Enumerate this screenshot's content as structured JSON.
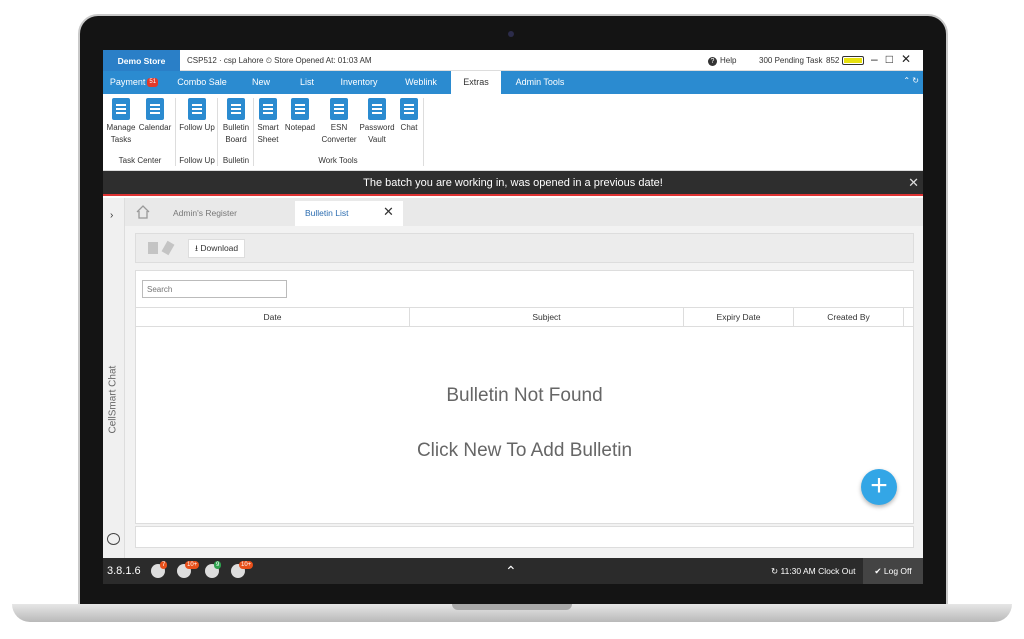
{
  "titlebar": {
    "store": "Demo Store",
    "info": "CSP512  ·  csp Lahore   ⏲ Store Opened At: 01:03 AM",
    "help": "Help",
    "pending": "300 Pending Task",
    "battery_value": "852",
    "minimize": "–",
    "maximize": "□",
    "close": "✕"
  },
  "menu": {
    "items": [
      {
        "label": "Payment",
        "badge": "51"
      },
      {
        "label": "Combo Sale"
      },
      {
        "label": "New"
      },
      {
        "label": "List"
      },
      {
        "label": "Inventory"
      },
      {
        "label": "Weblink"
      },
      {
        "label": "Extras"
      },
      {
        "label": "Admin Tools"
      }
    ],
    "active": "Extras"
  },
  "ribbon": {
    "buttons": [
      {
        "label": "Manage Tasks",
        "icon": "clipboard-icon"
      },
      {
        "label": "Calendar",
        "icon": "calendar-icon"
      },
      {
        "label": "Follow Up",
        "icon": "person-icon"
      },
      {
        "label": "Bulletin Board",
        "icon": "bulletin-icon"
      },
      {
        "label": "Smart Sheet",
        "icon": "sheet-icon"
      },
      {
        "label": "Notepad",
        "icon": "notepad-icon"
      },
      {
        "label": "ESN Converter",
        "icon": "converter-icon"
      },
      {
        "label": "Password Vault",
        "icon": "vault-icon"
      },
      {
        "label": "Chat",
        "icon": "chat-icon"
      }
    ],
    "groups": [
      "Task Center",
      "Follow Up",
      "Bulletin",
      "Work Tools"
    ]
  },
  "notice": {
    "text": "The batch you are working in, was opened in a previous date!",
    "close": "✕"
  },
  "sidebar": {
    "chevron": "›",
    "chat_label": "CellSmart Chat"
  },
  "tabs": [
    {
      "label": "Admin's Register"
    },
    {
      "label": "Bulletin List"
    }
  ],
  "tab_close": "✕",
  "toolbar": {
    "download": "⭳ Download"
  },
  "search": {
    "placeholder": "Search"
  },
  "table": {
    "columns": [
      "Date",
      "Subject",
      "Expiry Date",
      "Created By"
    ]
  },
  "empty": {
    "line1": "Bulletin Not Found",
    "line2": "Click New To Add Bulletin"
  },
  "fab": "+",
  "status": {
    "version": "3.8.1.6",
    "badges": [
      "7",
      "10+",
      "9",
      "10+"
    ],
    "caret": "⌃",
    "clock_out": "↻  11:30 AM Clock Out",
    "log_off": "✔ Log Off"
  }
}
